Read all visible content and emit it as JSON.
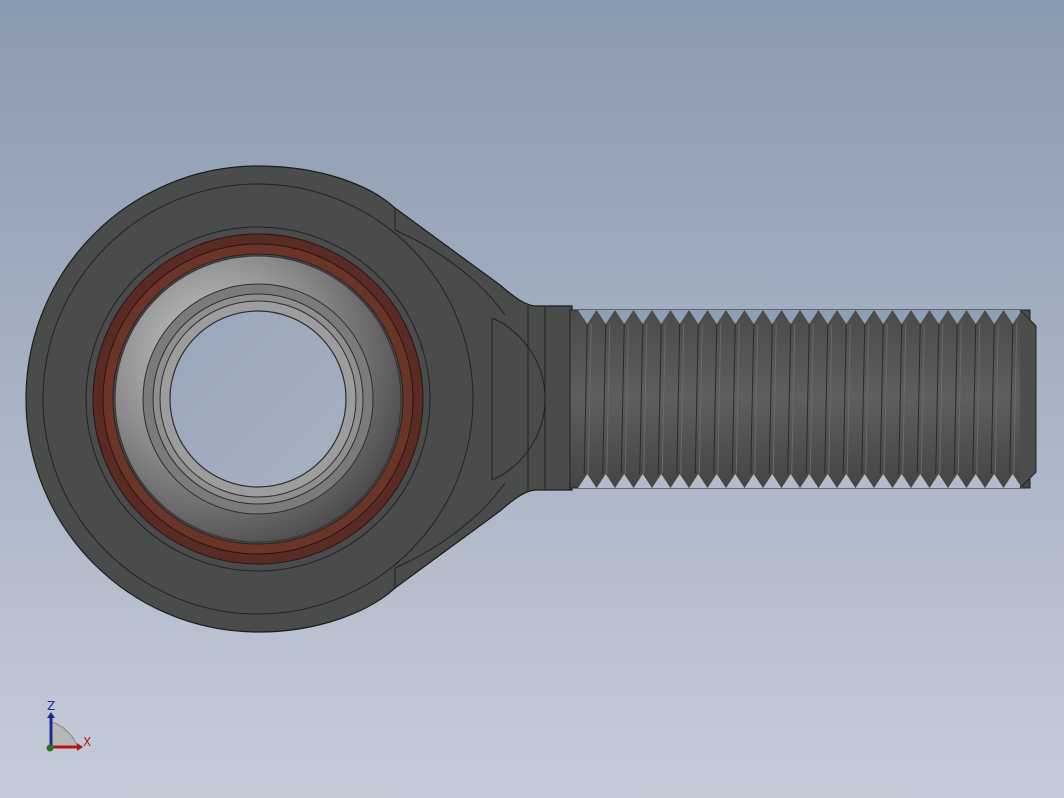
{
  "viewport": {
    "background_top": "#8a9ab0",
    "background_bottom": "#c6cbd8",
    "model": "rod-end",
    "part_color": "#4a4b4b",
    "seal_color": "#5a2b24"
  },
  "triad": {
    "z_label": "Z",
    "x_label": "X",
    "z_color": "#1a2a9a",
    "x_color": "#b01818"
  }
}
